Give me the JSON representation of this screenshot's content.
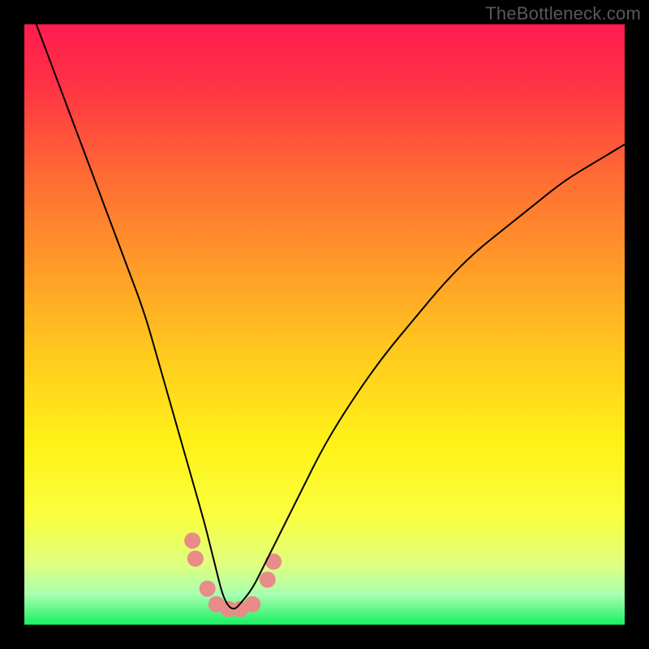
{
  "watermark": "TheBottleneck.com",
  "chart_data": {
    "type": "line",
    "title": "",
    "xlabel": "",
    "ylabel": "",
    "xlim": [
      0,
      100
    ],
    "ylim": [
      0,
      100
    ],
    "background_gradient_stops": [
      {
        "offset": 0.0,
        "color": "#ff1c4f"
      },
      {
        "offset": 0.1,
        "color": "#ff3245"
      },
      {
        "offset": 0.25,
        "color": "#ff6a34"
      },
      {
        "offset": 0.4,
        "color": "#ff9a28"
      },
      {
        "offset": 0.55,
        "color": "#ffca1e"
      },
      {
        "offset": 0.7,
        "color": "#fff218"
      },
      {
        "offset": 0.82,
        "color": "#f9ff40"
      },
      {
        "offset": 0.9,
        "color": "#dfff80"
      },
      {
        "offset": 0.95,
        "color": "#a8ffb0"
      },
      {
        "offset": 1.0,
        "color": "#18f060"
      }
    ],
    "series": [
      {
        "name": "bottleneck-curve",
        "color": "#000000",
        "stroke_width": 2,
        "x": [
          2,
          5,
          8,
          11,
          14,
          17,
          20,
          22,
          24,
          26,
          28,
          30,
          31,
          32,
          33,
          34,
          35,
          36,
          38,
          40,
          43,
          46,
          50,
          55,
          60,
          65,
          70,
          75,
          80,
          85,
          90,
          95,
          100
        ],
        "y": [
          100,
          92,
          84,
          76,
          68,
          60,
          52,
          45,
          38,
          31,
          24,
          17,
          13,
          9,
          5,
          3,
          2.5,
          3.5,
          6,
          10,
          16,
          22,
          30,
          38,
          45,
          51,
          57,
          62,
          66,
          70,
          74,
          77,
          80
        ]
      }
    ],
    "markers": {
      "name": "highlight-dots",
      "color": "#e98b88",
      "radius": 10,
      "points": [
        {
          "x": 28.0,
          "y": 14.0
        },
        {
          "x": 28.5,
          "y": 11.0
        },
        {
          "x": 30.5,
          "y": 6.0
        },
        {
          "x": 32.0,
          "y": 3.4
        },
        {
          "x": 34.0,
          "y": 2.6
        },
        {
          "x": 36.0,
          "y": 2.6
        },
        {
          "x": 38.0,
          "y": 3.4
        },
        {
          "x": 40.5,
          "y": 7.5
        },
        {
          "x": 41.5,
          "y": 10.5
        }
      ]
    }
  }
}
